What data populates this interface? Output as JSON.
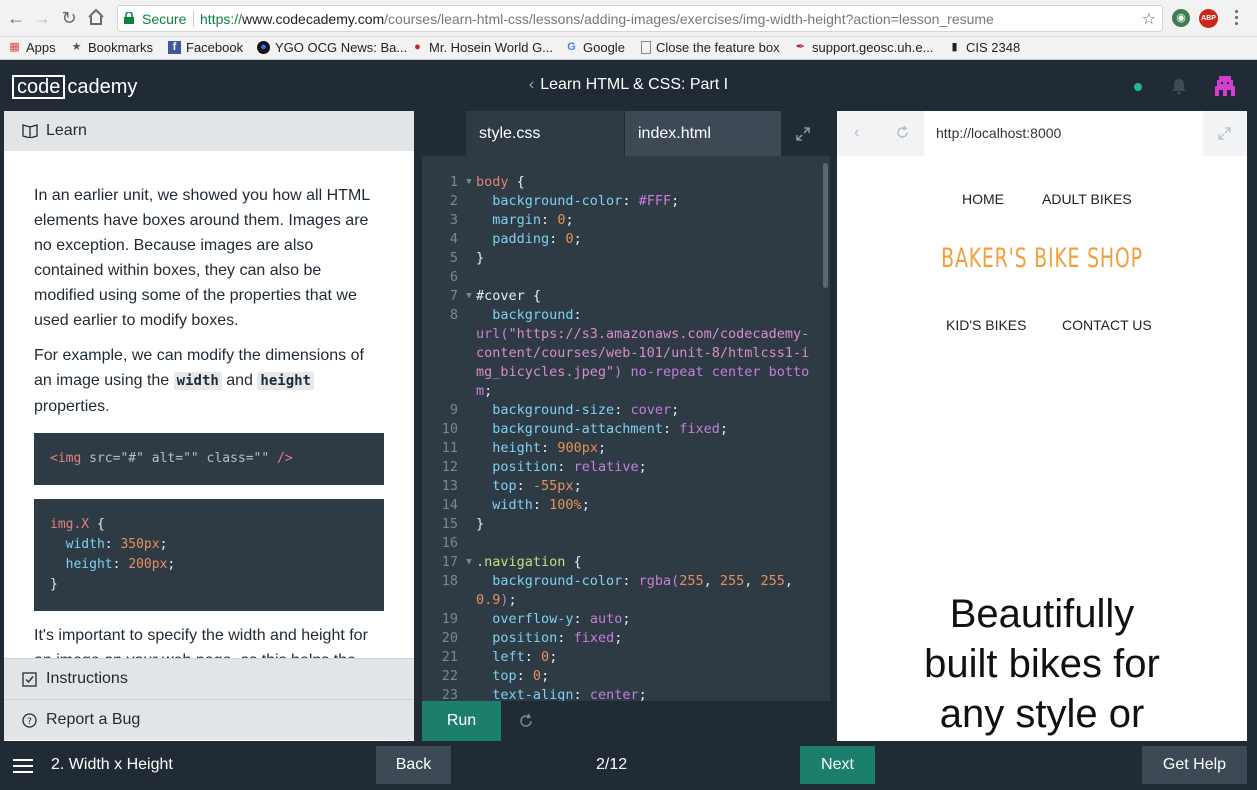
{
  "browser": {
    "secure_label": "Secure",
    "url_scheme": "https://",
    "url_host": "www.codecademy.com",
    "url_path": "/courses/learn-html-css/lessons/adding-images/exercises/img-width-height?action=lesson_resume",
    "ext_abp": "ABP",
    "bookmarks": [
      {
        "label": "Apps",
        "icon": "apps-grid-icon"
      },
      {
        "label": "Bookmarks",
        "icon": "star-icon"
      },
      {
        "label": "Facebook",
        "icon": "facebook-icon"
      },
      {
        "label": "YGO OCG News: Ba...",
        "icon": "ygo-icon"
      },
      {
        "label": "Mr. Hosein World G...",
        "icon": "apple-icon"
      },
      {
        "label": "Google",
        "icon": "google-icon"
      },
      {
        "label": "Close the feature box",
        "icon": "page-icon"
      },
      {
        "label": "support.geosc.uh.e...",
        "icon": "feather-icon"
      },
      {
        "label": "CIS 2348",
        "icon": "book-icon"
      }
    ]
  },
  "header": {
    "logo_box": "code",
    "logo_rest": "cademy",
    "course_title": "Learn HTML & CSS: Part I"
  },
  "learn": {
    "tab_label": "Learn",
    "paragraph1": "In an earlier unit, we showed you how all HTML elements have boxes around them. Images are no exception. Because images are also contained within boxes, they can also be modified using some of the properties that we used earlier to modify boxes.",
    "paragraph2_a": "For example, we can modify the dimensions of an image using the ",
    "paragraph2_code1": "width",
    "paragraph2_b": " and ",
    "paragraph2_code2": "height",
    "paragraph2_c": " properties.",
    "code1": {
      "tag": "<img",
      "src": " src=\"#\"",
      "alt": " alt=\"\"",
      "cls": " class=\"\"",
      "end": " />"
    },
    "code2": {
      "sel": "img.X",
      "open": " {",
      "p1": "width",
      "v1": "350px",
      "p2": "height",
      "v2": "200px",
      "close": "}"
    },
    "paragraph3": "It's important to specify the width and height for an image on your web page, as this helps the browser know exactly how much space should be",
    "instructions_label": "Instructions",
    "report_label": "Report a Bug"
  },
  "editor": {
    "tabs": [
      "style.css",
      "index.html"
    ],
    "run_label": "Run",
    "lines": [
      {
        "n": "1",
        "fold": true
      },
      {
        "n": "2"
      },
      {
        "n": "3"
      },
      {
        "n": "4"
      },
      {
        "n": "5"
      },
      {
        "n": "6"
      },
      {
        "n": "7",
        "fold": true
      },
      {
        "n": "8"
      },
      {
        "n": "9"
      },
      {
        "n": "10"
      },
      {
        "n": "11"
      },
      {
        "n": "12"
      },
      {
        "n": "13"
      },
      {
        "n": "14"
      },
      {
        "n": "15"
      },
      {
        "n": "16"
      },
      {
        "n": "17",
        "fold": true
      },
      {
        "n": "18"
      },
      {
        "n": "19"
      },
      {
        "n": "20"
      },
      {
        "n": "21"
      },
      {
        "n": "22"
      },
      {
        "n": "23"
      }
    ],
    "code": {
      "l1_sel": "body",
      "l1_rest": " {",
      "l2_p": "background-color",
      "l2_v": "#FFF",
      "l3_p": "margin",
      "l3_v": "0",
      "l4_p": "padding",
      "l4_v": "0",
      "l5": "}",
      "l7_sel": "#cover",
      "l7_rest": " {",
      "l8_p": "background",
      "l8_fn": "url(",
      "l8_str": "\"https://s3.amazonaws.com/codecademy-content/courses/web-101/unit-8/htmlcss1-img_bicycles.jpeg\"",
      "l8_fnclose": ")",
      "l8_rest": " no-repeat center bottom",
      "l9_p": "background-size",
      "l9_v": "cover",
      "l10_p": "background-attachment",
      "l10_v": "fixed",
      "l11_p": "height",
      "l11_v": "900px",
      "l12_p": "position",
      "l12_v": "relative",
      "l13_p": "top",
      "l13_v": "-55px",
      "l14_p": "width",
      "l14_v": "100%",
      "l15": "}",
      "l17_sel": ".navigation",
      "l17_rest": " {",
      "l18_p": "background-color",
      "l18_fn": "rgba(",
      "l18_a": "255",
      "l18_b": "255",
      "l18_c": "255",
      "l18_d": "0.9",
      "l18_close": ")",
      "l19_p": "overflow-y",
      "l19_v": "auto",
      "l20_p": "position",
      "l20_v": "fixed",
      "l21_p": "left",
      "l21_v": "0",
      "l22_p": "top",
      "l22_v": "0",
      "l23_p": "text-align",
      "l23_v": "center"
    }
  },
  "preview": {
    "url": "http://localhost:8000",
    "nav_home": "HOME",
    "nav_adult": "ADULT BIKES",
    "site_title": "BAKER'S BIKE SHOP",
    "nav_kids": "KID'S BIKES",
    "nav_contact": "CONTACT US",
    "hero_line1": "Beautifully",
    "hero_line2": "built bikes for",
    "hero_line3": "any style or"
  },
  "bottom": {
    "lesson_name": "2. Width x Height",
    "back_label": "Back",
    "progress": "2/12",
    "next_label": "Next",
    "help_label": "Get Help"
  },
  "colors": {
    "brand_dark": "#202b35",
    "accent_green": "#1b7f6b",
    "site_title_orange": "#f29f3c"
  }
}
